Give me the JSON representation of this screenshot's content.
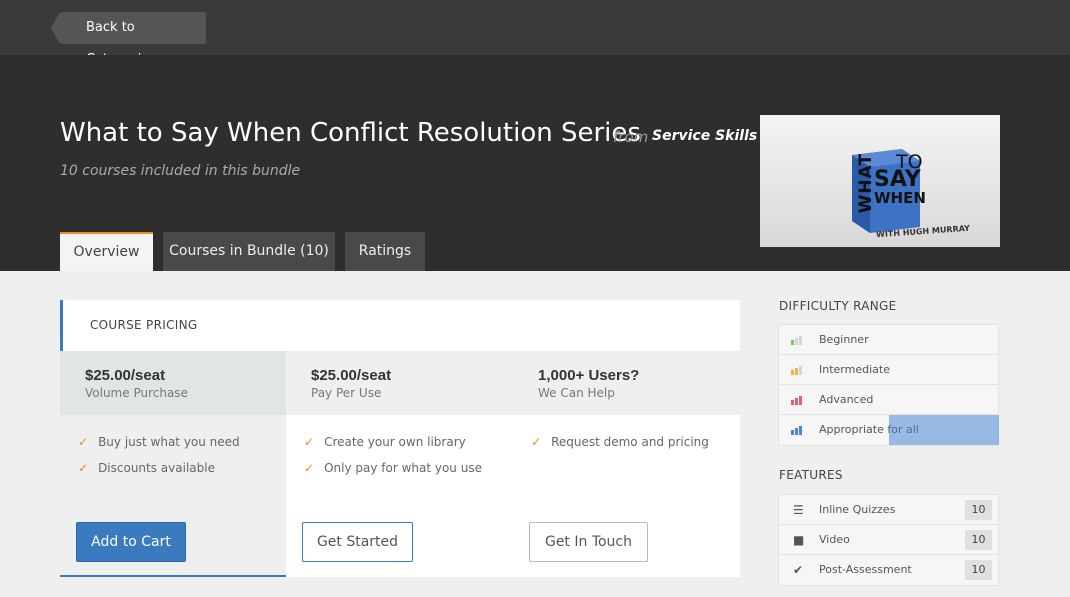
{
  "nav": {
    "back_label": "Back to Categories"
  },
  "hero": {
    "title": "What to Say When Conflict Resolution Series",
    "from": "from",
    "provider": "Service Skills",
    "subtitle": "10 courses included in this bundle",
    "thumbnail": {
      "words": [
        "WHAT",
        "TO",
        "SAY",
        "WHEN"
      ],
      "credit": "WITH HUGH MURRAY"
    }
  },
  "tabs": [
    {
      "label": "Overview",
      "active": true
    },
    {
      "label": "Courses in Bundle (10)",
      "active": false
    },
    {
      "label": "Ratings",
      "active": false
    }
  ],
  "pricing": {
    "heading": "COURSE PRICING",
    "columns": [
      {
        "price": "$25.00/seat",
        "sub": "Volume Purchase",
        "features": [
          "Buy just what you need",
          "Discounts available"
        ],
        "button": "Add to Cart"
      },
      {
        "price": "$25.00/seat",
        "sub": "Pay Per Use",
        "features": [
          "Create your own library",
          "Only pay for what you use"
        ],
        "button": "Get Started"
      },
      {
        "price": "1,000+ Users?",
        "sub": "We Can Help",
        "features": [
          "Request demo and pricing"
        ],
        "button": "Get In Touch"
      }
    ]
  },
  "difficulty": {
    "heading": "DIFFICULTY RANGE",
    "items": [
      {
        "label": "Beginner",
        "color": "#7cc46b"
      },
      {
        "label": "Intermediate",
        "color": "#f2b33d"
      },
      {
        "label": "Advanced",
        "color": "#e0606e"
      },
      {
        "label": "Appropriate for all",
        "color": "#4a86d6"
      }
    ]
  },
  "features": {
    "heading": "FEATURES",
    "items": [
      {
        "label": "Inline Quizzes",
        "count": "10",
        "icon": "list-icon"
      },
      {
        "label": "Video",
        "count": "10",
        "icon": "video-camera-icon"
      },
      {
        "label": "Post-Assessment",
        "count": "10",
        "icon": "checkmark-icon"
      }
    ]
  },
  "colors": {
    "accent": "#3a7bc0",
    "tab_accent": "#f08a24",
    "check": "#f08a24"
  }
}
